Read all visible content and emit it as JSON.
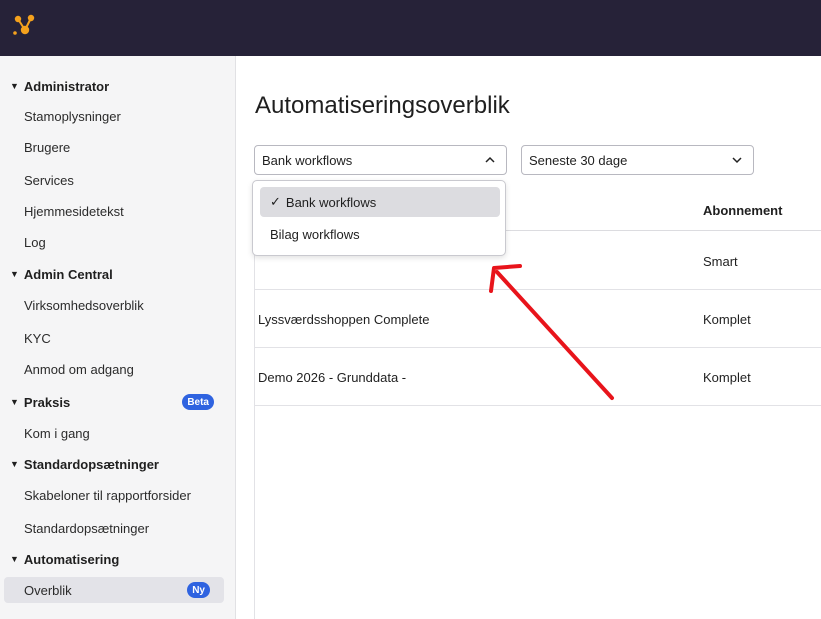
{
  "app": {
    "brand_color": "#262238",
    "accent_color": "#2f63e0",
    "logo_icon": "brand-logo-icon"
  },
  "sidebar": {
    "sections": [
      {
        "label": "Administrator",
        "items": [
          "Stamoplysninger",
          "Brugere",
          "Services",
          "Hjemmesidetekst",
          "Log"
        ]
      },
      {
        "label": "Admin Central",
        "items": [
          "Virksomhedsoverblik",
          "KYC",
          "Anmod om adgang"
        ]
      },
      {
        "label": "Praksis",
        "badge": "Beta",
        "items": [
          "Kom i gang"
        ]
      },
      {
        "label": "Standardopsætninger",
        "items": [
          "Skabeloner til rapportforsider",
          "Standardopsætninger"
        ]
      },
      {
        "label": "Automatisering",
        "items": [
          "Overblik"
        ],
        "item_badge": "Ny"
      }
    ]
  },
  "main": {
    "title": "Automatiseringsoverblik",
    "workflow_select": {
      "value": "Bank workflows"
    },
    "period_select": {
      "value": "Seneste 30 dage"
    },
    "dropdown": {
      "options": [
        {
          "label": "Bank workflows",
          "check": "✓"
        },
        {
          "label": "Bilag workflows"
        }
      ]
    },
    "table": {
      "header_subscription": "Abonnement",
      "rows": [
        {
          "name": "",
          "subscription": "Smart"
        },
        {
          "name": "Lyssværdsshoppen Complete",
          "subscription": "Komplet"
        },
        {
          "name": "Demo 2026 - Grunddata -",
          "subscription": "Komplet"
        }
      ]
    }
  },
  "annotation": {
    "arrow_color": "#e8141b"
  }
}
